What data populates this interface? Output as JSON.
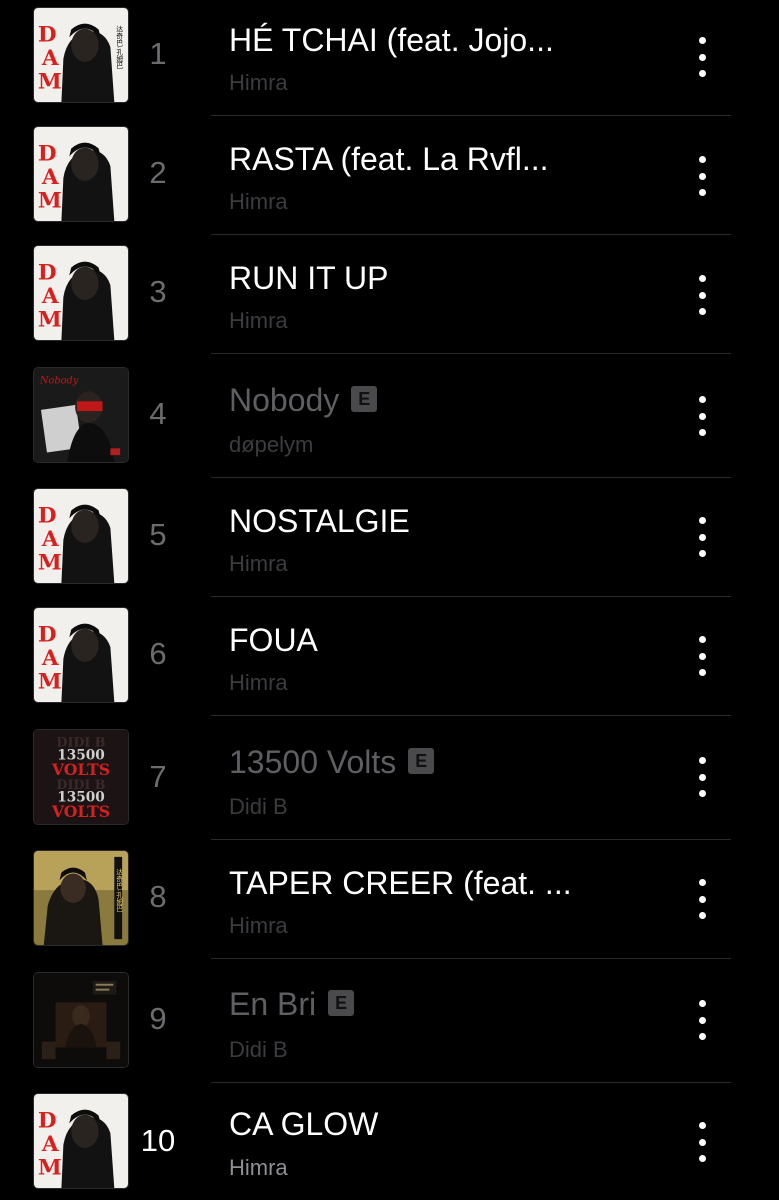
{
  "tracks": [
    {
      "number": "1",
      "title": "HÉ TCHAI (feat. Jojo...",
      "artist": "Himra",
      "explicit": false,
      "art": "dadi-cover"
    },
    {
      "number": "2",
      "title": "RASTA (feat. La Rvfl...",
      "artist": "Himra",
      "explicit": false,
      "art": "dadi-cover"
    },
    {
      "number": "3",
      "title": "RUN IT UP",
      "artist": "Himra",
      "explicit": false,
      "art": "dadi-cover"
    },
    {
      "number": "4",
      "title": "Nobody",
      "artist": "døpelym",
      "explicit": true,
      "art": "nobody-cover"
    },
    {
      "number": "5",
      "title": "NOSTALGIE",
      "artist": "Himra",
      "explicit": false,
      "art": "dadi-cover"
    },
    {
      "number": "6",
      "title": "FOUA",
      "artist": "Himra",
      "explicit": false,
      "art": "dadi-cover"
    },
    {
      "number": "7",
      "title": "13500 Volts",
      "artist": "Didi B",
      "explicit": true,
      "art": "volts-cover"
    },
    {
      "number": "8",
      "title": "TAPER CREER (feat. ...",
      "artist": "Himra",
      "explicit": false,
      "art": "taper-cover"
    },
    {
      "number": "9",
      "title": "En Bri",
      "artist": "Didi B",
      "explicit": true,
      "art": "enbri-cover"
    },
    {
      "number": "10",
      "title": "CA GLOW",
      "artist": "Himra",
      "explicit": false,
      "art": "dadi-cover"
    }
  ],
  "explicit_badge": "E",
  "cover_text": {
    "volts_line1": "13500",
    "volts_line2": "VOLTS",
    "volts_ghost": "DIDI B",
    "cjk": "达奇巴·孔姆巴"
  },
  "colors": {
    "background": "#000000",
    "title": "#ffffff",
    "dim_title": "#5f5f63",
    "artist": "#3c3c40",
    "accent_red": "#d8201e"
  }
}
